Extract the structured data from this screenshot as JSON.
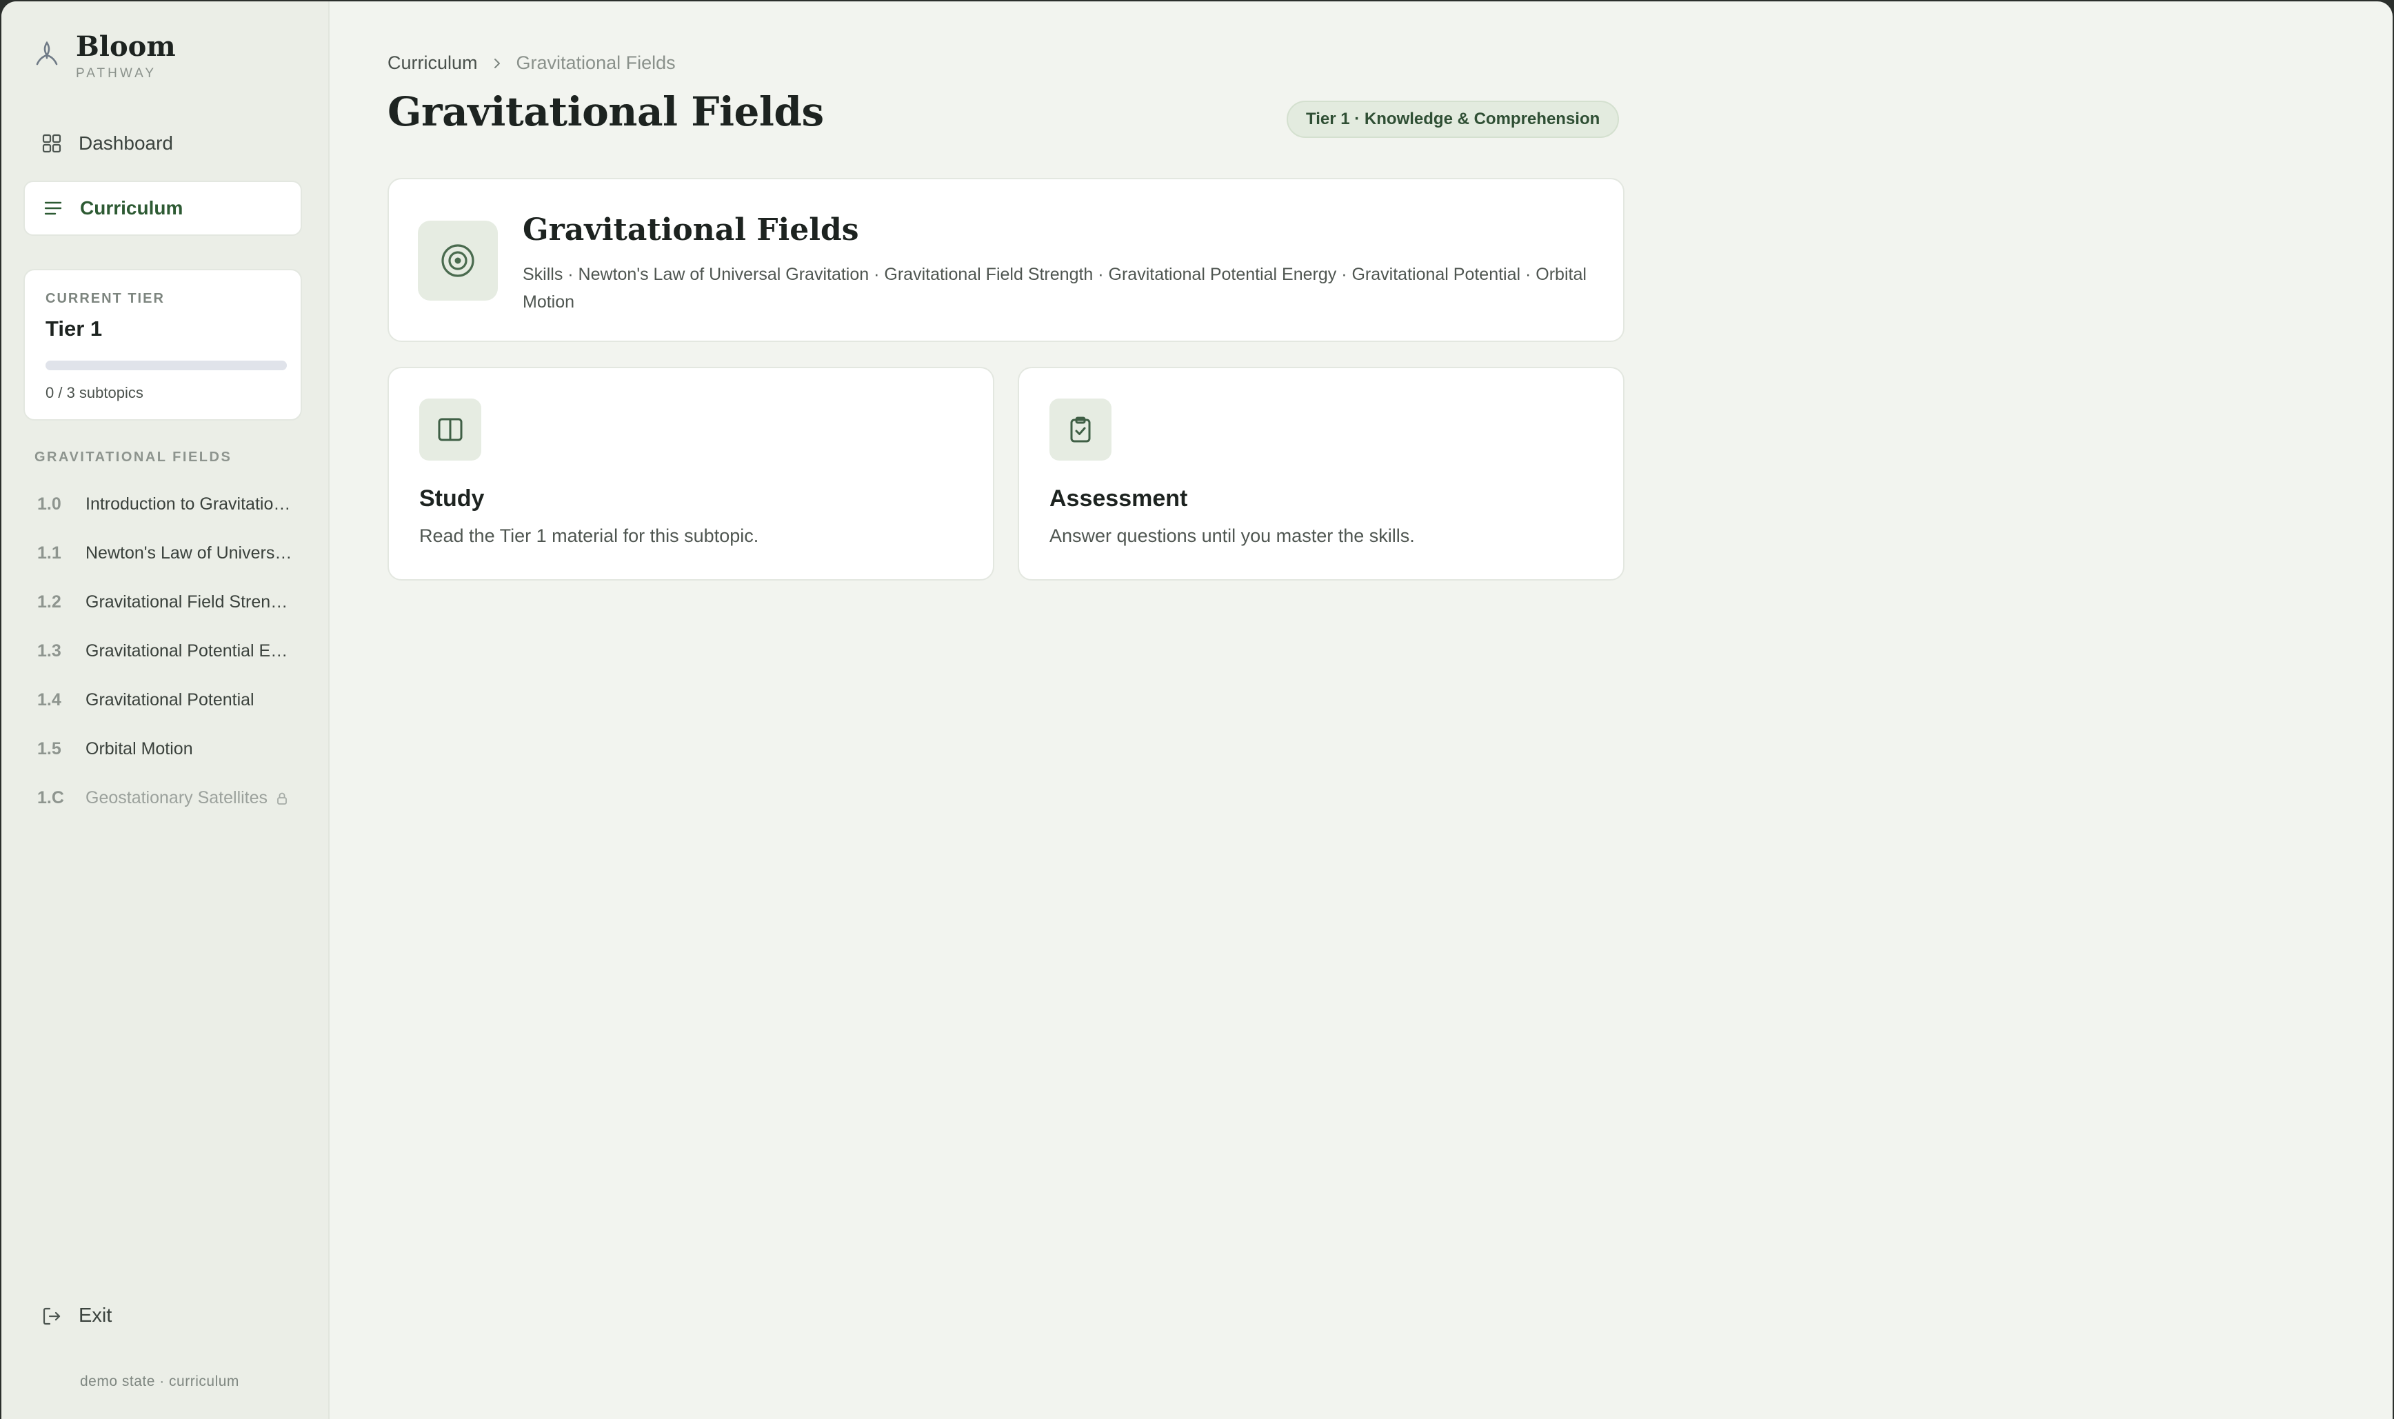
{
  "brand": {
    "name": "Bloom",
    "subtitle": "PATHWAY"
  },
  "nav": {
    "items": [
      {
        "label": "Dashboard",
        "icon": "grid-icon",
        "active": false
      },
      {
        "label": "Curriculum",
        "icon": "list-icon",
        "active": true
      }
    ],
    "exit_label": "Exit"
  },
  "tier_card": {
    "caption": "CURRENT TIER",
    "name": "Tier 1",
    "progress": 0,
    "progress_text": "0 / 3 subtopics"
  },
  "subtopics": {
    "caption": "GRAVITATIONAL FIELDS",
    "items": [
      {
        "num": "1.0",
        "label": "Introduction to Gravitational Fields",
        "locked": false
      },
      {
        "num": "1.1",
        "label": "Newton's Law of Universal Gravitation",
        "locked": false
      },
      {
        "num": "1.2",
        "label": "Gravitational Field Strength",
        "locked": false
      },
      {
        "num": "1.3",
        "label": "Gravitational Potential Energy",
        "locked": false
      },
      {
        "num": "1.4",
        "label": "Gravitational Potential",
        "locked": false
      },
      {
        "num": "1.5",
        "label": "Orbital Motion",
        "locked": false
      },
      {
        "num": "1.C",
        "label": "Geostationary Satellites",
        "locked": true
      }
    ]
  },
  "footer_note": "demo state · curriculum",
  "breadcrumb": {
    "root": "Curriculum",
    "current": "Gravitational Fields"
  },
  "page": {
    "title": "Gravitational Fields",
    "badge": "Tier 1 · Knowledge & Comprehension"
  },
  "topic": {
    "title": "Gravitational Fields",
    "skills": "Skills · Newton's Law of Universal Gravitation · Gravitational Field Strength · Gravitational Potential Energy · Gravitational Potential · Orbital Motion"
  },
  "actions": {
    "study": {
      "title": "Study",
      "desc": "Read the Tier 1 material for this subtopic."
    },
    "assessment": {
      "title": "Assessment",
      "desc": "Answer questions until you master the skills."
    }
  },
  "colors": {
    "accent": "#2d5a33",
    "sidebar_bg": "#ebeee7",
    "main_bg": "#f2f4ef",
    "icon_tile": "#e6ece2"
  }
}
